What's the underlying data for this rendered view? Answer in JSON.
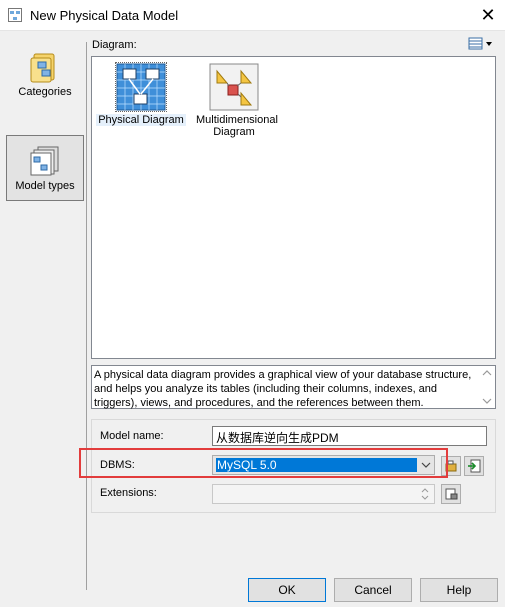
{
  "window": {
    "title": "New Physical Data Model",
    "close_glyph": "✕"
  },
  "left_pane": {
    "items": [
      {
        "label": "Categories",
        "icon": "categories-folder-icon",
        "selected": false
      },
      {
        "label": "Model types",
        "icon": "model-types-icon",
        "selected": true
      }
    ]
  },
  "diagram": {
    "label": "Diagram:",
    "items": [
      {
        "label": "Physical Diagram",
        "icon": "physical-diagram-icon",
        "selected": true
      },
      {
        "label": "Multidimensional Diagram",
        "icon": "multidimensional-diagram-icon",
        "selected": false
      }
    ],
    "description": "A physical data diagram provides a graphical view of your database structure, and helps you analyze its tables (including their columns, indexes, and triggers), views, and procedures, and the references between them."
  },
  "form": {
    "model_name_label": "Model name:",
    "model_name_value": "从数据库逆向生成PDM",
    "dbms_label": "DBMS:",
    "dbms_value": "MySQL 5.0",
    "extensions_label": "Extensions:",
    "extensions_value": ""
  },
  "buttons": {
    "ok": "OK",
    "cancel": "Cancel",
    "help": "Help"
  },
  "colors": {
    "highlight": "#e23c3c",
    "selection_blue": "#0078d7"
  }
}
